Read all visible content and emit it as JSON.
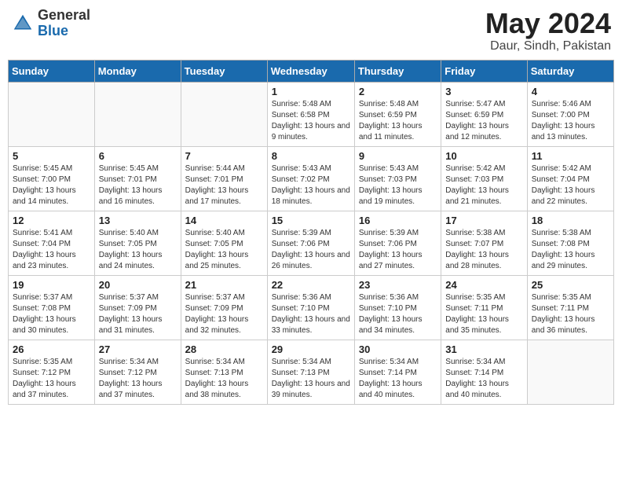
{
  "header": {
    "logo_general": "General",
    "logo_blue": "Blue",
    "month_title": "May 2024",
    "location": "Daur, Sindh, Pakistan"
  },
  "weekdays": [
    "Sunday",
    "Monday",
    "Tuesday",
    "Wednesday",
    "Thursday",
    "Friday",
    "Saturday"
  ],
  "weeks": [
    [
      {
        "day": "",
        "sunrise": "",
        "sunset": "",
        "daylight": ""
      },
      {
        "day": "",
        "sunrise": "",
        "sunset": "",
        "daylight": ""
      },
      {
        "day": "",
        "sunrise": "",
        "sunset": "",
        "daylight": ""
      },
      {
        "day": "1",
        "sunrise": "Sunrise: 5:48 AM",
        "sunset": "Sunset: 6:58 PM",
        "daylight": "Daylight: 13 hours and 9 minutes."
      },
      {
        "day": "2",
        "sunrise": "Sunrise: 5:48 AM",
        "sunset": "Sunset: 6:59 PM",
        "daylight": "Daylight: 13 hours and 11 minutes."
      },
      {
        "day": "3",
        "sunrise": "Sunrise: 5:47 AM",
        "sunset": "Sunset: 6:59 PM",
        "daylight": "Daylight: 13 hours and 12 minutes."
      },
      {
        "day": "4",
        "sunrise": "Sunrise: 5:46 AM",
        "sunset": "Sunset: 7:00 PM",
        "daylight": "Daylight: 13 hours and 13 minutes."
      }
    ],
    [
      {
        "day": "5",
        "sunrise": "Sunrise: 5:45 AM",
        "sunset": "Sunset: 7:00 PM",
        "daylight": "Daylight: 13 hours and 14 minutes."
      },
      {
        "day": "6",
        "sunrise": "Sunrise: 5:45 AM",
        "sunset": "Sunset: 7:01 PM",
        "daylight": "Daylight: 13 hours and 16 minutes."
      },
      {
        "day": "7",
        "sunrise": "Sunrise: 5:44 AM",
        "sunset": "Sunset: 7:01 PM",
        "daylight": "Daylight: 13 hours and 17 minutes."
      },
      {
        "day": "8",
        "sunrise": "Sunrise: 5:43 AM",
        "sunset": "Sunset: 7:02 PM",
        "daylight": "Daylight: 13 hours and 18 minutes."
      },
      {
        "day": "9",
        "sunrise": "Sunrise: 5:43 AM",
        "sunset": "Sunset: 7:03 PM",
        "daylight": "Daylight: 13 hours and 19 minutes."
      },
      {
        "day": "10",
        "sunrise": "Sunrise: 5:42 AM",
        "sunset": "Sunset: 7:03 PM",
        "daylight": "Daylight: 13 hours and 21 minutes."
      },
      {
        "day": "11",
        "sunrise": "Sunrise: 5:42 AM",
        "sunset": "Sunset: 7:04 PM",
        "daylight": "Daylight: 13 hours and 22 minutes."
      }
    ],
    [
      {
        "day": "12",
        "sunrise": "Sunrise: 5:41 AM",
        "sunset": "Sunset: 7:04 PM",
        "daylight": "Daylight: 13 hours and 23 minutes."
      },
      {
        "day": "13",
        "sunrise": "Sunrise: 5:40 AM",
        "sunset": "Sunset: 7:05 PM",
        "daylight": "Daylight: 13 hours and 24 minutes."
      },
      {
        "day": "14",
        "sunrise": "Sunrise: 5:40 AM",
        "sunset": "Sunset: 7:05 PM",
        "daylight": "Daylight: 13 hours and 25 minutes."
      },
      {
        "day": "15",
        "sunrise": "Sunrise: 5:39 AM",
        "sunset": "Sunset: 7:06 PM",
        "daylight": "Daylight: 13 hours and 26 minutes."
      },
      {
        "day": "16",
        "sunrise": "Sunrise: 5:39 AM",
        "sunset": "Sunset: 7:06 PM",
        "daylight": "Daylight: 13 hours and 27 minutes."
      },
      {
        "day": "17",
        "sunrise": "Sunrise: 5:38 AM",
        "sunset": "Sunset: 7:07 PM",
        "daylight": "Daylight: 13 hours and 28 minutes."
      },
      {
        "day": "18",
        "sunrise": "Sunrise: 5:38 AM",
        "sunset": "Sunset: 7:08 PM",
        "daylight": "Daylight: 13 hours and 29 minutes."
      }
    ],
    [
      {
        "day": "19",
        "sunrise": "Sunrise: 5:37 AM",
        "sunset": "Sunset: 7:08 PM",
        "daylight": "Daylight: 13 hours and 30 minutes."
      },
      {
        "day": "20",
        "sunrise": "Sunrise: 5:37 AM",
        "sunset": "Sunset: 7:09 PM",
        "daylight": "Daylight: 13 hours and 31 minutes."
      },
      {
        "day": "21",
        "sunrise": "Sunrise: 5:37 AM",
        "sunset": "Sunset: 7:09 PM",
        "daylight": "Daylight: 13 hours and 32 minutes."
      },
      {
        "day": "22",
        "sunrise": "Sunrise: 5:36 AM",
        "sunset": "Sunset: 7:10 PM",
        "daylight": "Daylight: 13 hours and 33 minutes."
      },
      {
        "day": "23",
        "sunrise": "Sunrise: 5:36 AM",
        "sunset": "Sunset: 7:10 PM",
        "daylight": "Daylight: 13 hours and 34 minutes."
      },
      {
        "day": "24",
        "sunrise": "Sunrise: 5:35 AM",
        "sunset": "Sunset: 7:11 PM",
        "daylight": "Daylight: 13 hours and 35 minutes."
      },
      {
        "day": "25",
        "sunrise": "Sunrise: 5:35 AM",
        "sunset": "Sunset: 7:11 PM",
        "daylight": "Daylight: 13 hours and 36 minutes."
      }
    ],
    [
      {
        "day": "26",
        "sunrise": "Sunrise: 5:35 AM",
        "sunset": "Sunset: 7:12 PM",
        "daylight": "Daylight: 13 hours and 37 minutes."
      },
      {
        "day": "27",
        "sunrise": "Sunrise: 5:34 AM",
        "sunset": "Sunset: 7:12 PM",
        "daylight": "Daylight: 13 hours and 37 minutes."
      },
      {
        "day": "28",
        "sunrise": "Sunrise: 5:34 AM",
        "sunset": "Sunset: 7:13 PM",
        "daylight": "Daylight: 13 hours and 38 minutes."
      },
      {
        "day": "29",
        "sunrise": "Sunrise: 5:34 AM",
        "sunset": "Sunset: 7:13 PM",
        "daylight": "Daylight: 13 hours and 39 minutes."
      },
      {
        "day": "30",
        "sunrise": "Sunrise: 5:34 AM",
        "sunset": "Sunset: 7:14 PM",
        "daylight": "Daylight: 13 hours and 40 minutes."
      },
      {
        "day": "31",
        "sunrise": "Sunrise: 5:34 AM",
        "sunset": "Sunset: 7:14 PM",
        "daylight": "Daylight: 13 hours and 40 minutes."
      },
      {
        "day": "",
        "sunrise": "",
        "sunset": "",
        "daylight": ""
      }
    ]
  ]
}
